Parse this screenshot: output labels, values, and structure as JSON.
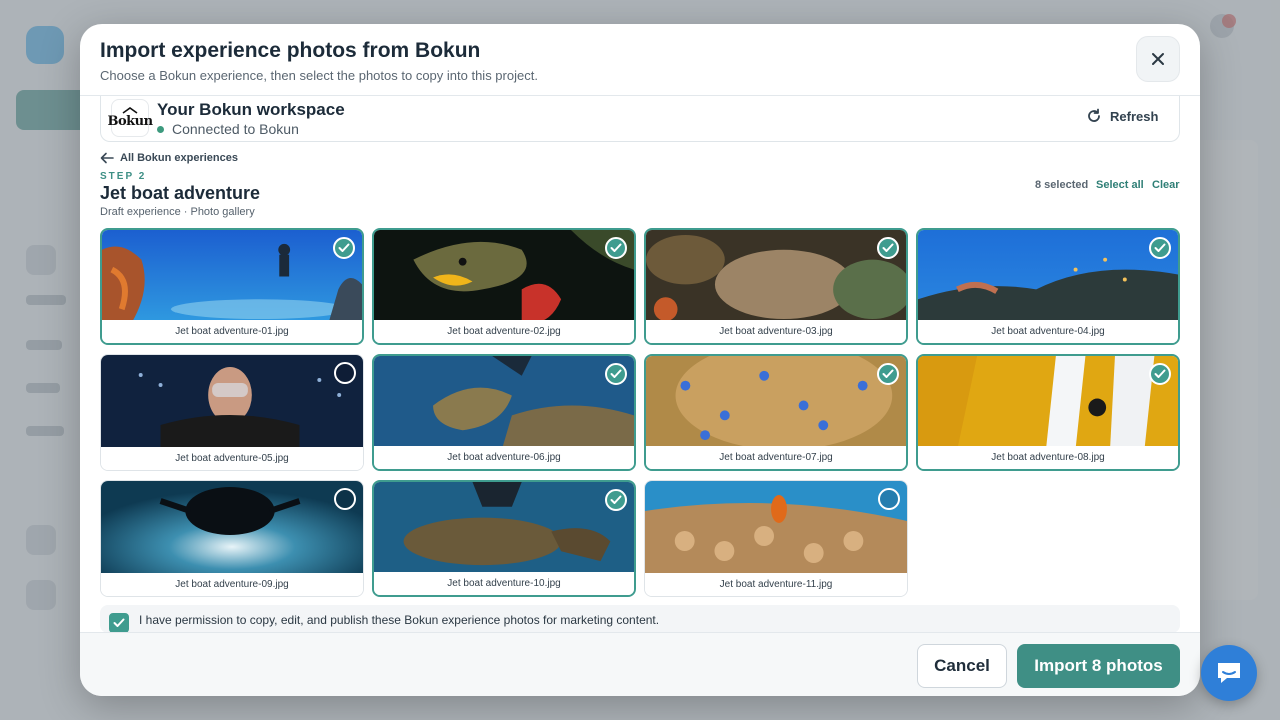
{
  "modal": {
    "title": "Import experience photos from Bokun",
    "subtitle": "Choose a Bokun experience, then select the photos to copy into this project."
  },
  "workspace": {
    "logo_text": "Bokun",
    "name": "Your Bokun workspace",
    "status": "Connected to Bokun",
    "refresh_label": "Refresh"
  },
  "navigation": {
    "back_label": "All Bokun experiences"
  },
  "experience": {
    "step": "STEP 2",
    "title": "Jet boat adventure",
    "meta": "Draft experience · Photo gallery"
  },
  "selection": {
    "count_label": "8 selected",
    "select_all_label": "Select all",
    "clear_label": "Clear"
  },
  "photos": [
    {
      "filename": "Jet boat adventure-01.jpg",
      "selected": true
    },
    {
      "filename": "Jet boat adventure-02.jpg",
      "selected": true
    },
    {
      "filename": "Jet boat adventure-03.jpg",
      "selected": true
    },
    {
      "filename": "Jet boat adventure-04.jpg",
      "selected": true
    },
    {
      "filename": "Jet boat adventure-05.jpg",
      "selected": false
    },
    {
      "filename": "Jet boat adventure-06.jpg",
      "selected": true
    },
    {
      "filename": "Jet boat adventure-07.jpg",
      "selected": true
    },
    {
      "filename": "Jet boat adventure-08.jpg",
      "selected": true
    },
    {
      "filename": "Jet boat adventure-09.jpg",
      "selected": false
    },
    {
      "filename": "Jet boat adventure-10.jpg",
      "selected": true
    },
    {
      "filename": "Jet boat adventure-11.jpg",
      "selected": false
    }
  ],
  "permission": {
    "checked": true,
    "text": "I have permission to copy, edit, and publish these Bokun experience photos for marketing content."
  },
  "footer": {
    "cancel_label": "Cancel",
    "import_label": "Import 8 photos"
  },
  "icons": {
    "close": "close-icon",
    "refresh": "refresh-icon",
    "back": "arrow-left-icon",
    "check": "check-icon",
    "chat": "chat-icon"
  },
  "colors": {
    "accent": "#3f9c8f",
    "primary_button": "#3f8f85",
    "chat_fab": "#2f7fd8"
  }
}
